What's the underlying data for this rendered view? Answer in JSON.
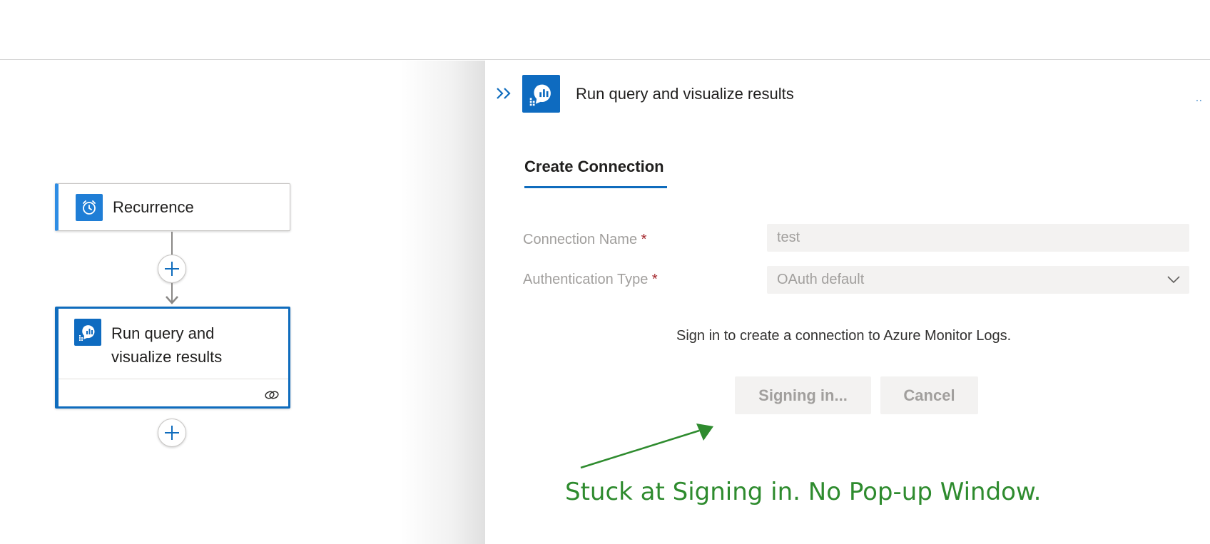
{
  "workflow": {
    "recurrence_card": {
      "title": "Recurrence",
      "icon": "alarm-clock-icon"
    },
    "run_query_card": {
      "title": "Run query and visualize results",
      "icon": "azure-monitor-logs-icon",
      "footer_icon": "connection-link-icon"
    },
    "add_step_icon": "plus-icon"
  },
  "panel": {
    "title": "Run query and visualize results",
    "collapse_icon": "double-chevron-right-icon",
    "more_icon": "ellipsis-icon",
    "more_text": "..",
    "tab": "Create Connection",
    "connection_name": {
      "label": "Connection Name",
      "required_mark": "*",
      "value": "test"
    },
    "auth_type": {
      "label": "Authentication Type",
      "required_mark": "*",
      "value": "OAuth default"
    },
    "sign_in_message": "Sign in to create a connection to Azure Monitor Logs.",
    "signing_in_button": "Signing in...",
    "cancel_button": "Cancel"
  },
  "annotation": {
    "text": "Stuck at Signing in. No Pop-up Window.",
    "color": "#2e8b2e"
  },
  "colors": {
    "accent": "#0f6cbd",
    "icon_bg": "#0e6bc0"
  }
}
